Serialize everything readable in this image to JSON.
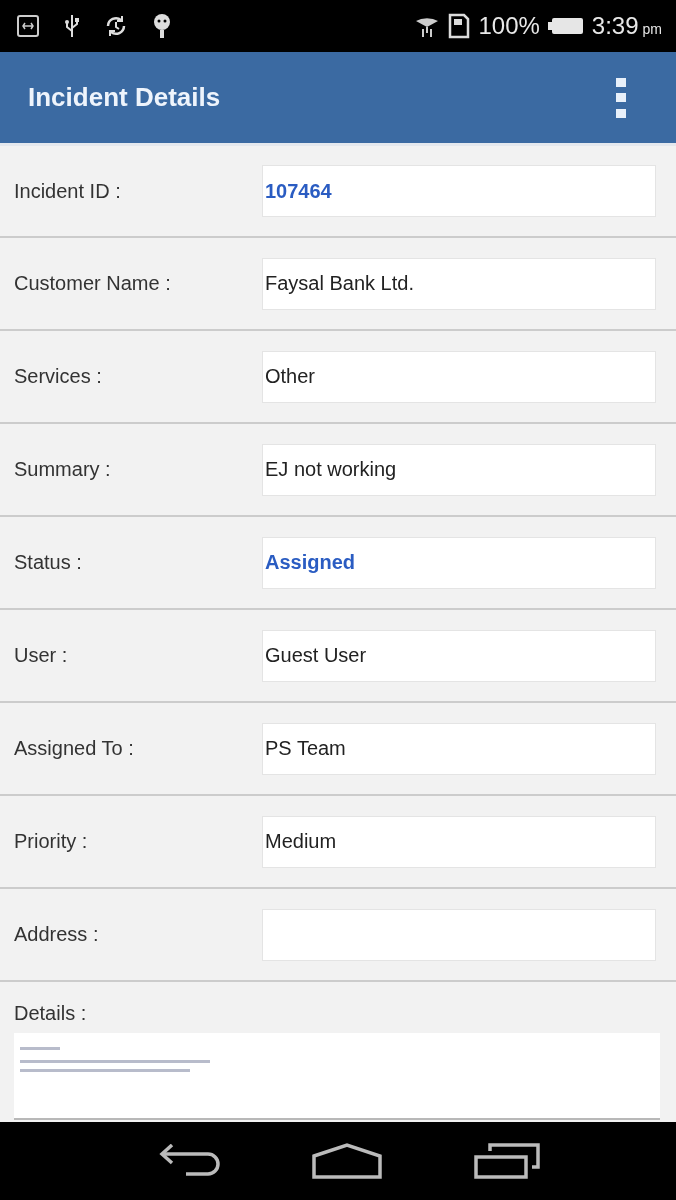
{
  "status_bar": {
    "battery": "100%",
    "time": "3:39",
    "meridiem": "pm"
  },
  "app_bar": {
    "title": "Incident Details"
  },
  "fields": [
    {
      "label": "Incident ID :",
      "value": "107464",
      "highlighted": true
    },
    {
      "label": "Customer Name :",
      "value": "Faysal Bank Ltd.",
      "highlighted": false
    },
    {
      "label": "Services :",
      "value": "Other",
      "highlighted": false
    },
    {
      "label": "Summary :",
      "value": "EJ not working",
      "highlighted": false
    },
    {
      "label": "Status :",
      "value": "Assigned",
      "highlighted": true
    },
    {
      "label": "User :",
      "value": "Guest User",
      "highlighted": false
    },
    {
      "label": "Assigned To :",
      "value": "PS Team",
      "highlighted": false
    },
    {
      "label": "Priority :",
      "value": "Medium",
      "highlighted": false
    },
    {
      "label": "Address :"
    }
  ],
  "details": {
    "label": "Details :"
  }
}
